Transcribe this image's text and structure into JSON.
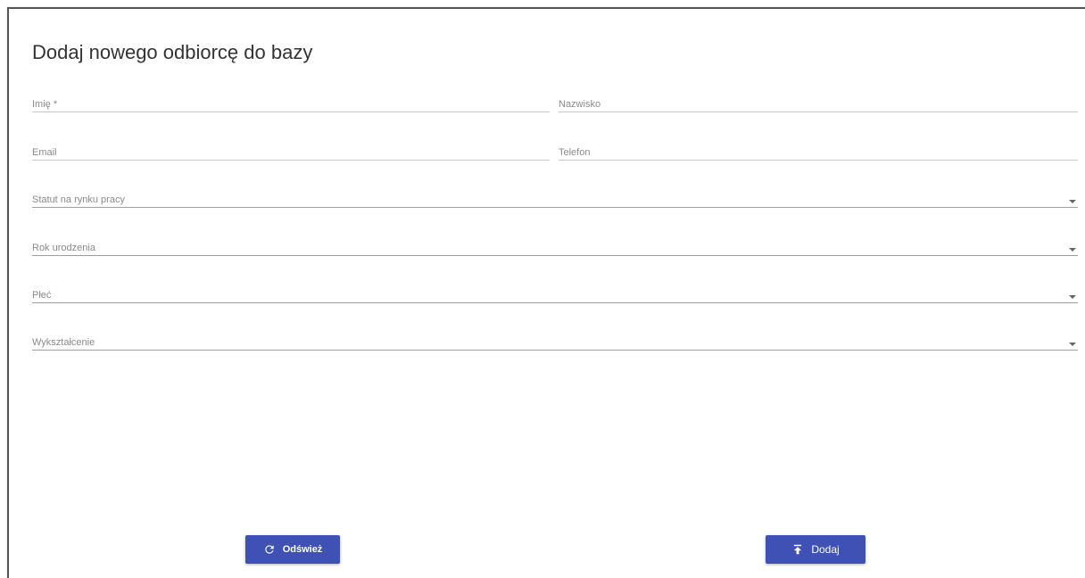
{
  "form": {
    "title": "Dodaj nowego odbiorcę do bazy",
    "fields": {
      "first_name": {
        "label": "Imię *",
        "value": ""
      },
      "last_name": {
        "label": "Nazwisko",
        "value": ""
      },
      "email": {
        "label": "Email",
        "value": ""
      },
      "phone": {
        "label": "Telefon",
        "value": ""
      },
      "labor_status": {
        "label": "Statut na rynku pracy",
        "value": ""
      },
      "birth_year": {
        "label": "Rok urodzenia",
        "value": ""
      },
      "gender": {
        "label": "Płeć",
        "value": ""
      },
      "education": {
        "label": "Wykształcenie",
        "value": ""
      }
    }
  },
  "buttons": {
    "refresh": {
      "label": "Odśwież",
      "icon": "refresh-icon"
    },
    "add": {
      "label": "Dodaj",
      "icon": "upload-icon"
    }
  },
  "colors": {
    "primary": "#3f51b5",
    "label": "#8a8a8a",
    "title": "#333333"
  }
}
